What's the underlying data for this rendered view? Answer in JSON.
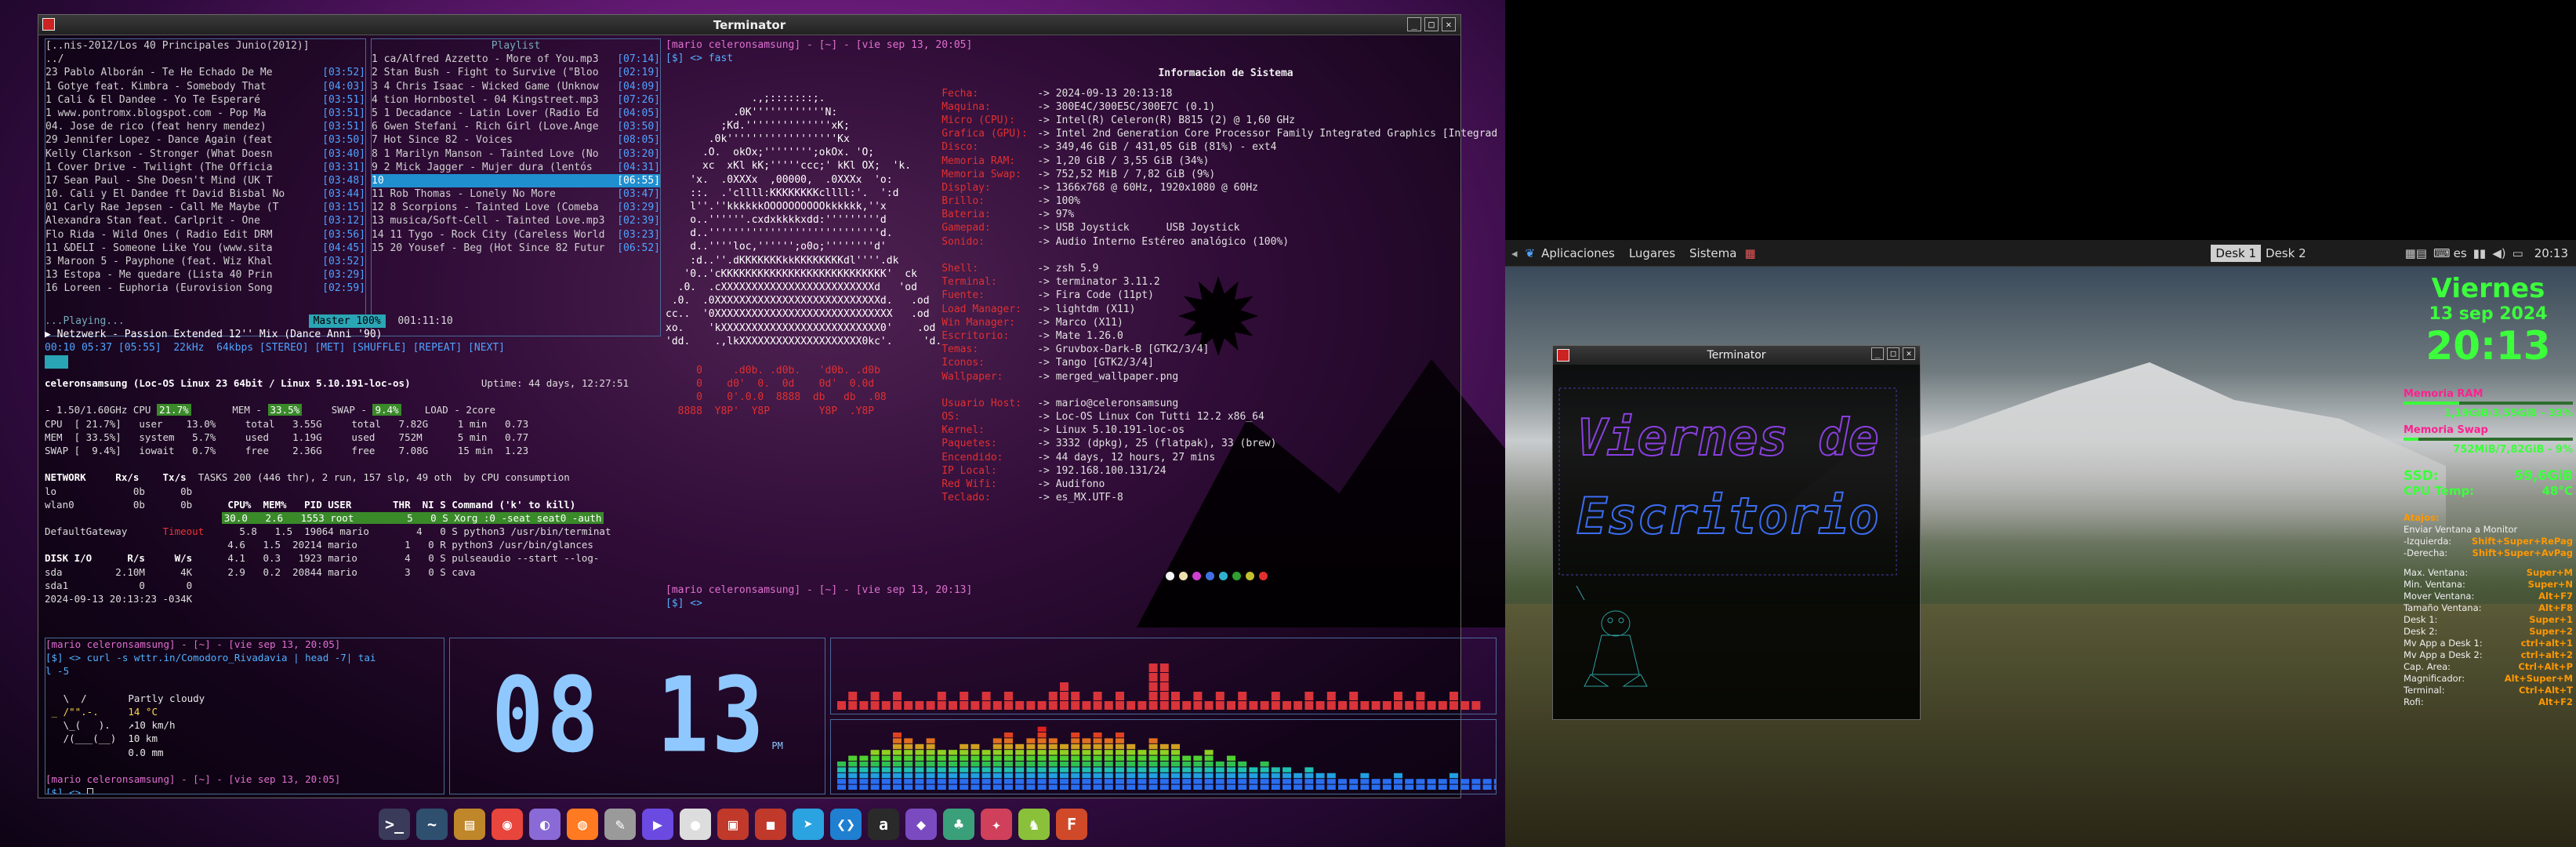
{
  "main_window": {
    "title": "Terminator"
  },
  "filemgr": {
    "header": "[..nis-2012/Los 40 Principales Junio(2012)]",
    "rows": [
      {
        "t": "../",
        "d": ""
      },
      {
        "t": "23 Pablo Alborán - Te He Echado De Me",
        "d": "[03:52]"
      },
      {
        "t": "1 Gotye feat. Kimbra - Somebody That",
        "d": "[04:03]"
      },
      {
        "t": "1 Cali & El Dandee - Yo Te Esperaré",
        "d": "[03:51]"
      },
      {
        "t": "1 www.pontromx.blogspot.com - Pop Ma",
        "d": "[03:51]"
      },
      {
        "t": "04. Jose de rico (feat henry mendez)",
        "d": "[03:51]"
      },
      {
        "t": "29 Jennifer Lopez - Dance Again (feat",
        "d": "[03:50]"
      },
      {
        "t": "Kelly Clarkson - Stronger (What Doesn",
        "d": "[03:40]"
      },
      {
        "t": "1 Cover Drive - Twilight (The Officia",
        "d": "[03:31]"
      },
      {
        "t": "17 Sean Paul - She Doesn't Mind (UK T",
        "d": "[03:48]"
      },
      {
        "t": "10. Cali y El Dandee ft David Bisbal No",
        "d": "[03:44]"
      },
      {
        "t": "01 Carly Rae Jepsen - Call Me Maybe (T",
        "d": "[03:15]"
      },
      {
        "t": "Alexandra Stan feat. Carlprit - One",
        "d": "[03:12]"
      },
      {
        "t": "Flo Rida - Wild Ones ( Radio Edit DRM",
        "d": "[03:56]"
      },
      {
        "t": "11 &DELI - Someone Like You (www.sita",
        "d": "[04:45]"
      },
      {
        "t": "3 Maroon 5 - Payphone (feat. Wiz Khal",
        "d": "[03:52]"
      },
      {
        "t": "13 Estopa - Me quedare (Lista 40 Prin",
        "d": "[03:29]"
      },
      {
        "t": "16 Loreen - Euphoria (Eurovision Song",
        "d": "[02:59]"
      }
    ]
  },
  "playlist": {
    "header": "Playlist",
    "rows": [
      {
        "t": "1 ca/Alfred Azzetto - More of You.mp3",
        "d": "[07:14]"
      },
      {
        "t": "2 Stan Bush - Fight to Survive (\"Bloo",
        "d": "[02:19]"
      },
      {
        "t": "3 4 Chris Isaac - Wicked Game (Unknow",
        "d": "[04:09]"
      },
      {
        "t": "4 tion Hornbostel - 04 Kingstreet.mp3",
        "d": "[07:26]"
      },
      {
        "t": "5 1 Decadance - Latin Lover (Radio Ed",
        "d": "[04:05]"
      },
      {
        "t": "6 Gwen Stefani - Rich Girl (Love.Ange",
        "d": "[03:50]"
      },
      {
        "t": "7 Hot Since 82 - Voices",
        "d": "[08:05]"
      },
      {
        "t": "8 1 Marilyn Manson - Tainted Love (No",
        "d": "[03:20]"
      },
      {
        "t": "9 2 Mick Jagger - Mujer dura (lentós",
        "d": "[04:31]"
      },
      {
        "t": "10 ",
        "d": "[06:55]"
      },
      {
        "t": "11 Rob Thomas - Lonely No More",
        "d": "[03:47]"
      },
      {
        "t": "12 8 Scorpions - Tainted Love (Comeba",
        "d": "[03:29]"
      },
      {
        "t": "13 musica/Soft-Cell - Tainted Love.mp3",
        "d": "[02:39]"
      },
      {
        "t": "14 11 Tygo - Rock City (Careless World",
        "d": "[03:23]"
      },
      {
        "t": "15 20 Yousef - Beg (Hot Since 82 Futur",
        "d": "[06:52]"
      }
    ]
  },
  "player": {
    "playing_label": "...Playing...",
    "master": "Master 100%",
    "time": "001:11:10",
    "song": "▶ Netzwerk - Passion Extended 12'' Mix (Dance Anni '90)",
    "status": "00:10 05:37 [05:55]  22kHz  64kbps [STEREO] [MET] [SHUFFLE] [REPEAT] [NEXT]"
  },
  "glances": {
    "host_line": "celeronsamsung (Loc-OS Linux 23 64bit / Linux 5.10.191-loc-os)",
    "uptime": "Uptime: 44 days, 12:27:51",
    "cpu_hdr": "- 1.50/1.60GHz CPU",
    "cpu_pct": "21.7%",
    "mem_hdr": "MEM -",
    "mem_pct": "33.5%",
    "swap_hdr": "SWAP -",
    "swap_pct": "9.4%",
    "load_hdr": "LOAD - 2core",
    "lines": [
      "CPU  [ 21.7%]   user    13.0%     total   3.55G     total   7.82G     1 min   0.73",
      "MEM  [ 33.5%]   system   5.7%     used    1.19G     used    752M      5 min   0.77",
      "SWAP [  9.4%]   iowait   0.7%     free    2.36G     free    7.08G     15 min  1.23"
    ],
    "network_hdr": "NETWORK     Rx/s    Tx/s",
    "tasks": "TASKS 200 (446 thr), 2 run, 157 slp, 49 oth  by CPU consumption",
    "net_rows": [
      "lo             0b      0b",
      "wlan0          0b      0b"
    ],
    "proc_hdr": "CPU%  MEM%   PID USER       THR  NI S Command ('k' to kill)",
    "procs": [
      "30.0   2.6   1553 root         5   0 S Xorg :0 -seat seat0 -auth",
      " 5.8   1.5  19064 mario        4   0 S python3 /usr/bin/terminat",
      " 4.6   1.5  20214 mario        1   0 R python3 /usr/bin/glances",
      " 4.1   0.3   1923 mario        4   0 S pulseaudio --start --log-",
      " 2.9   0.2  20844 mario        3   0 S cava"
    ],
    "gateway": "DefaultGateway",
    "gateway_val": "Timeout",
    "disk_hdr": "DISK I/O      R/s     W/s",
    "disk_rows": [
      "sda         2.10M      4K",
      "sda1            0       0"
    ],
    "datetime": "2024-09-13 20:13:23 -034K"
  },
  "fastfetch": {
    "prompt1": "[mario celeronsamsung] - [~] - [vie sep 13, 20:05]",
    "prompt2": "[$] <> fast",
    "ascii": [
      "              .,;:::::::;.",
      "           .0K''''''''''''N:",
      "         ;Kd.''''''''''''''xK;",
      "       .0k''''''''''''''''''Kx",
      "      .O.  okOx;'''''''';okOx. 'O;",
      "      xc  xKl kK;'''''ccc;' kKl OX;  'k.",
      "    'x.  .0XXXx  ,00000,  .0XXXx  'o:",
      "    ::.  .'cllll:KKKKKKKKcllll:'.  ':d",
      "    l''.''kkkkkkOOOOOOOOOOkkkkkk,''x",
      "    o..''''''.cxdxkkkkxdd:'''''''''d",
      "    d..''''''''''''''''''''''''''''d.",
      "    d..''''loc,'''''';o0o;''''''''d'",
      "    :d..''.dKKKKKKKkkKKKKKKKKdl''''.dk",
      "   '0..'cKKKKKKKKKKKKKKKKKKKKKKKKKKK'  ck",
      "  .0.  .cXXXXXXXXXXXXXXXXXXXXXXXXXd   'od",
      " .0.  .0XXXXXXXXXXXXXXXXXXXXXXXXXXXd.   .od",
      "cc..  '0XXXXXXXXXXXXXXXXXXXXXXXXXXXXX   .od",
      "xo.    'kXXXXXXXXXXXXXXXXXXXXXXXXXX0'    .od",
      "'dd.    .,lkXXXXXXXXXXXXXXXXXXXX0kc'.     'd."
    ],
    "ascii_red": [
      "     0     .d0b. .d0b.   'd0b. .d0b",
      "     0    d0'  0.  0d    0d'  0.0d",
      "     0    0'.0.0  8888  db   db  .08",
      "  8888  Y8P'  Y8P        Y8P  .Y8P"
    ],
    "info_title": "Informacion de Sistema",
    "rows": [
      {
        "k": "Fecha:",
        "v": "2024-09-13 20:13:18"
      },
      {
        "k": "Maquina:",
        "v": "300E4C/300E5C/300E7C (0.1)"
      },
      {
        "k": "Micro (CPU):",
        "v": "Intel(R) Celeron(R) B815 (2) @ 1,60 GHz"
      },
      {
        "k": "Grafica (GPU):",
        "v": "Intel 2nd Generation Core Processor Family Integrated Graphics [Integrada]"
      },
      {
        "k": "Disco:",
        "v": "349,46 GiB / 431,05 GiB (81%) - ext4"
      },
      {
        "k": "Memoria RAM:",
        "v": "1,20 GiB / 3,55 GiB (34%)"
      },
      {
        "k": "Memoria Swap:",
        "v": "752,52 MiB / 7,82 GiB (9%)"
      },
      {
        "k": "Display:",
        "v": "1366x768 @ 60Hz, 1920x1080 @ 60Hz"
      },
      {
        "k": "Brillo:",
        "v": "100%"
      },
      {
        "k": "Bateria:",
        "v": "97%"
      },
      {
        "k": "Gamepad:",
        "v": "USB Joystick      USB Joystick"
      },
      {
        "k": "Sonido:",
        "v": "Audio Interno Estéreo analógico (100%)"
      },
      {
        "k": "",
        "v": ""
      },
      {
        "k": "Shell:",
        "v": "zsh 5.9"
      },
      {
        "k": "Terminal:",
        "v": "terminator 3.11.2"
      },
      {
        "k": "Fuente:",
        "v": "Fira Code (11pt)"
      },
      {
        "k": "Load Manager:",
        "v": "lightdm (X11)"
      },
      {
        "k": "Win Manager:",
        "v": "Marco (X11)"
      },
      {
        "k": "Escritorio:",
        "v": "Mate 1.26.0"
      },
      {
        "k": "Temas:",
        "v": "Gruvbox-Dark-B [GTK2/3/4]"
      },
      {
        "k": "Iconos:",
        "v": "Tango [GTK2/3/4]"
      },
      {
        "k": "Wallpaper:",
        "v": "merged_wallpaper.png"
      },
      {
        "k": "",
        "v": ""
      },
      {
        "k": "Usuario Host:",
        "v": "mario@celeronsamsung"
      },
      {
        "k": "OS:",
        "v": "Loc-OS Linux Con Tutti 12.2 x86_64"
      },
      {
        "k": "Kernel:",
        "v": "Linux 5.10.191-loc-os"
      },
      {
        "k": "Paquetes:",
        "v": "3332 (dpkg), 25 (flatpak), 33 (brew)"
      },
      {
        "k": "Encendido:",
        "v": "44 days, 12 hours, 27 mins"
      },
      {
        "k": "IP Local:",
        "v": "192.168.100.131/24"
      },
      {
        "k": "Red Wifi:",
        "v": "Audifono"
      },
      {
        "k": "Teclado:",
        "v": "es_MX.UTF-8"
      }
    ],
    "dot_colors": [
      "#f5f5f5",
      "#f0e0b0",
      "#d040d0",
      "#4070e0",
      "#30b0d0",
      "#30a030",
      "#c0c030",
      "#e03030"
    ],
    "prompt3": "[mario celeronsamsung] - [~] - [vie sep 13, 20:13]",
    "prompt4": "[$] <>"
  },
  "weather": {
    "prompt1": "[mario celeronsamsung] - [~] - [vie sep 13, 20:05]",
    "cmd": "[$] <> curl -s wttr.in/Comodoro_Rivadavia | head -7| tai",
    "cmd2": "l -5",
    "art": [
      "   \\  /       Partly cloudy",
      " _ /\"\".-.     14 °C",
      "   \\_(   ).   ↗10 km/h",
      "   /(___(__)  10 km",
      "              0.0 mm"
    ],
    "prompt2": "[mario celeronsamsung] - [~] - [vie sep 13, 20:05]",
    "prompt3": "[$] <> "
  },
  "clock": {
    "time": "08 13",
    "ampm": "PM"
  },
  "cava": {
    "top": [
      1,
      2,
      1,
      2,
      1,
      2,
      1,
      1,
      1,
      2,
      1,
      2,
      1,
      2,
      1,
      2,
      1,
      1,
      1,
      2,
      3,
      2,
      1,
      2,
      1,
      2,
      1,
      1,
      5,
      5,
      2,
      1,
      2,
      1,
      2,
      1,
      2,
      1,
      1,
      2,
      1,
      1,
      2,
      1,
      2,
      1,
      2,
      1,
      1,
      1,
      2,
      1,
      2,
      1,
      1,
      2,
      1,
      1
    ],
    "bottom": [
      5,
      6,
      6,
      7,
      7,
      10,
      9,
      8,
      9,
      7,
      7,
      8,
      8,
      7,
      9,
      10,
      8,
      9,
      11,
      9,
      8,
      10,
      9,
      10,
      9,
      10,
      8,
      7,
      9,
      8,
      8,
      6,
      6,
      7,
      5,
      6,
      5,
      4,
      5,
      4,
      4,
      3,
      4,
      3,
      3,
      2,
      2,
      3,
      2,
      2,
      3,
      2,
      2,
      2,
      2,
      3,
      2,
      2,
      2,
      2,
      2
    ]
  },
  "dock": {
    "icons": [
      {
        "name": "terminal-icon",
        "color": "#3a3a5a",
        "glyph": ">_"
      },
      {
        "name": "system-monitor-icon",
        "color": "#2f4f6f",
        "glyph": "~"
      },
      {
        "name": "notes-icon",
        "color": "#c0862a",
        "glyph": "▤"
      },
      {
        "name": "chrome-icon",
        "color": "#e8453c",
        "glyph": "◉"
      },
      {
        "name": "browser-icon",
        "color": "#8a6ad6",
        "glyph": "◐"
      },
      {
        "name": "firefox-icon",
        "color": "#ff7a20",
        "glyph": "◍"
      },
      {
        "name": "text-editor-icon",
        "color": "#9a9a9a",
        "glyph": "✎"
      },
      {
        "name": "media-player-icon",
        "color": "#6a4ae0",
        "glyph": "▶"
      },
      {
        "name": "webcam-icon",
        "color": "#dddddd",
        "glyph": "●"
      },
      {
        "name": "archive-icon",
        "color": "#c0392b",
        "glyph": "▣"
      },
      {
        "name": "screen-recorder-icon",
        "color": "#c0392b",
        "glyph": "◼"
      },
      {
        "name": "telegram-icon",
        "color": "#2aa3e0",
        "glyph": "➤"
      },
      {
        "name": "vscode-icon",
        "color": "#1f7fd0",
        "glyph": "❮❯"
      },
      {
        "name": "amazon-icon",
        "color": "#2a2a2a",
        "glyph": "a"
      },
      {
        "name": "crystal-icon",
        "color": "#7a4ac0",
        "glyph": "◆"
      },
      {
        "name": "game-icon",
        "color": "#3aa07a",
        "glyph": "♣"
      },
      {
        "name": "gem-icon",
        "color": "#d0405a",
        "glyph": "✦"
      },
      {
        "name": "cat-app-icon",
        "color": "#8ac03a",
        "glyph": "♞"
      },
      {
        "name": "office-icon",
        "color": "#d04a2a",
        "glyph": "F"
      }
    ]
  },
  "panel": {
    "menus": [
      "Aplicaciones",
      "Lugares",
      "Sistema"
    ],
    "desks": [
      "Desk 1",
      "Desk 2"
    ],
    "lang": "es",
    "clock": "20:13"
  },
  "term2": {
    "title": "Terminator",
    "banner1": "Viernes de",
    "banner2": "Escritorio"
  },
  "conky": {
    "day": "Viernes",
    "date": "13 sep 2024",
    "time": "20:13",
    "ram_label": "Memoria RAM",
    "ram_val": "1,19GiB/3,55GiB - 33%",
    "ram_pct": 33,
    "swap_label": "Memoria Swap",
    "swap_val": "752MiB/7,82GiB - 9%",
    "swap_pct": 9,
    "ssd_label": "SSD:",
    "ssd_val": "59,6GiB",
    "temp_label": "CPU Temp:",
    "temp_val": "48°C",
    "shortcuts_label": "Atajos:",
    "shortcuts": [
      {
        "l": "Enviar Ventana a Monitor",
        "r": ""
      },
      {
        "l": "-Izquierda:",
        "r": "Shift+Super+RePag"
      },
      {
        "l": "-Derecha:",
        "r": "Shift+Super+AvPag"
      },
      {
        "l": "",
        "r": ""
      },
      {
        "l": "Max. Ventana:",
        "r": "Super+M"
      },
      {
        "l": "Min. Ventana:",
        "r": "Super+N"
      },
      {
        "l": "Mover Ventana:",
        "r": "Alt+F7"
      },
      {
        "l": "Tamaño Ventana:",
        "r": "Alt+F8"
      },
      {
        "l": "Desk 1:",
        "r": "Super+1"
      },
      {
        "l": "Desk 2:",
        "r": "Super+2"
      },
      {
        "l": "Mv App a Desk 1:",
        "r": "ctrl+alt+1"
      },
      {
        "l": "Mv App a Desk 2:",
        "r": "ctrl+alt+2"
      },
      {
        "l": "Cap. Area:",
        "r": "Ctrl+Alt+P"
      },
      {
        "l": "Magnificador:",
        "r": "Alt+Super+M"
      },
      {
        "l": "Terminal:",
        "r": "Ctrl+Alt+T"
      },
      {
        "l": "Rofi:",
        "r": "Alt+F2"
      }
    ]
  }
}
